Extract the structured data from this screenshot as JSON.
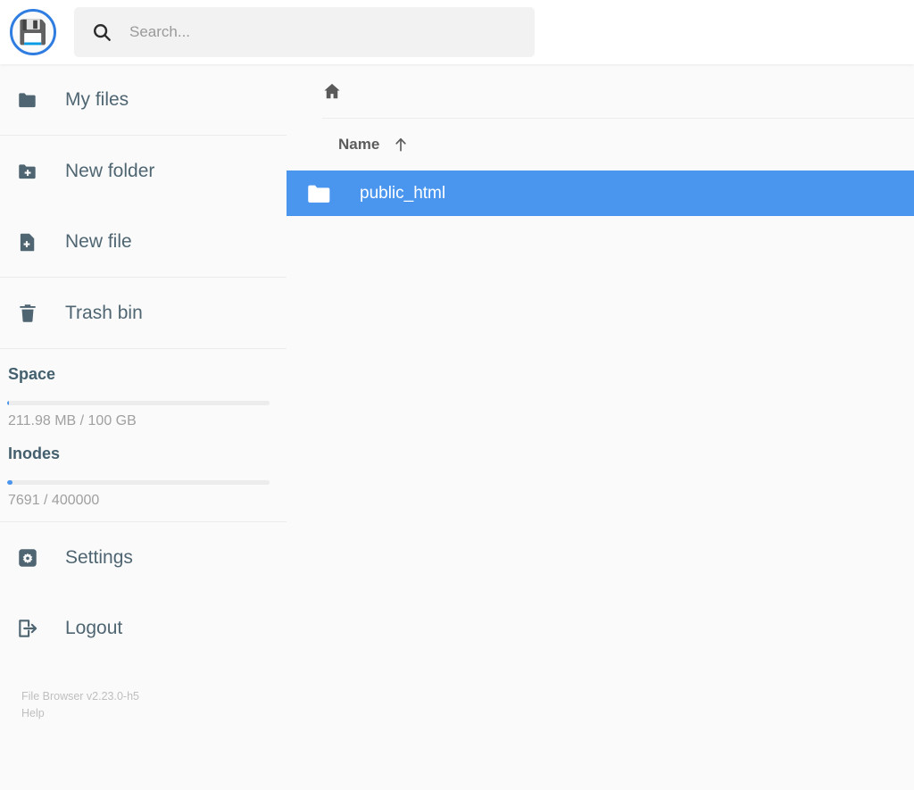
{
  "header": {
    "logo_icon": "floppy-disk-icon",
    "logo_glyph": "💾",
    "search": {
      "icon": "search-icon",
      "placeholder": "Search...",
      "value": ""
    }
  },
  "sidebar": {
    "nav": [
      {
        "label": "My files",
        "icon": "folder-icon"
      },
      {
        "label": "New folder",
        "icon": "folder-plus-icon"
      },
      {
        "label": "New file",
        "icon": "file-plus-icon"
      },
      {
        "label": "Trash bin",
        "icon": "trash-icon"
      }
    ],
    "usage": [
      {
        "title": "Space",
        "text": "211.98 MB / 100 GB",
        "percent": 0.7,
        "used": "211.98 MB",
        "total": "100 GB"
      },
      {
        "title": "Inodes",
        "text": "7691 / 400000",
        "percent": 2.0,
        "used": "7691",
        "total": "400000"
      }
    ],
    "actions": [
      {
        "label": "Settings",
        "icon": "gear-icon"
      },
      {
        "label": "Logout",
        "icon": "logout-icon"
      }
    ],
    "footer": {
      "version": "File Browser v2.23.0-h5",
      "help": "Help"
    }
  },
  "main": {
    "breadcrumb": {
      "home_icon": "home-icon"
    },
    "columns": {
      "name": "Name",
      "sort_icon": "arrow-up-icon",
      "sort_dir": "asc"
    },
    "items": [
      {
        "name": "public_html",
        "icon": "folder-icon",
        "type": "folder",
        "selected": true
      }
    ]
  },
  "colors": {
    "accent": "#4A96EE",
    "sidebar_text": "#4F6672",
    "muted_text": "#A0A0A0",
    "header_bg": "#FFFFFF",
    "page_bg": "#FAFAFA"
  }
}
